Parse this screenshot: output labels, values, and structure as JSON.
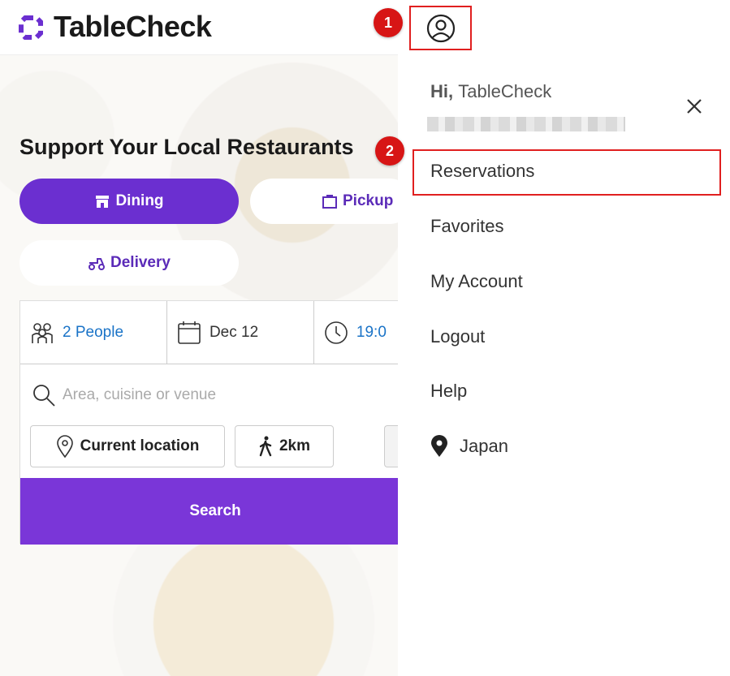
{
  "header": {
    "logo_text": "TableCheck",
    "logo_color": "#6b2fd0"
  },
  "hero": {
    "title": "Support Your Local Restaurants",
    "tabs": [
      {
        "label": "Dining",
        "icon": "store-icon",
        "active": true
      },
      {
        "label": "Pickup",
        "icon": "bag-icon",
        "active": false
      },
      {
        "label": "Delivery",
        "icon": "scooter-icon",
        "active": false
      }
    ]
  },
  "search": {
    "people": "2 People",
    "date": "Dec 12",
    "time": "19:0",
    "placeholder": "Area, cuisine or venue",
    "location_chip": "Current location",
    "distance_chip": "2km",
    "search_button": "Search"
  },
  "drawer": {
    "greeting_prefix": "Hi,",
    "greeting_name": "TableCheck",
    "menu": [
      {
        "label": "Reservations"
      },
      {
        "label": "Favorites"
      },
      {
        "label": "My Account"
      },
      {
        "label": "Logout"
      },
      {
        "label": "Help"
      },
      {
        "label": "Japan",
        "icon": "location-pin-icon"
      }
    ]
  },
  "annotations": {
    "step_1": "1",
    "step_2": "2",
    "highlight_color": "#e01f1f"
  },
  "colors": {
    "accent": "#6b2fd0",
    "link_blue": "#1a73c7",
    "search_button": "#7a36d8"
  }
}
